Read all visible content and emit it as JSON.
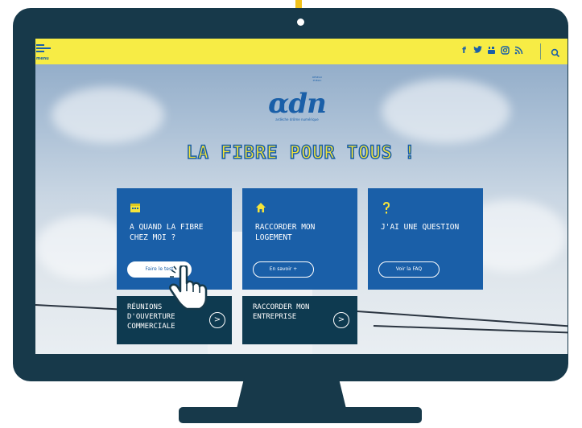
{
  "header": {
    "menu_label": "menu",
    "social_icons": [
      "facebook-icon",
      "twitter-icon",
      "youtube-icon",
      "instagram-icon",
      "rss-icon"
    ],
    "search_icon": "search-icon"
  },
  "logo": {
    "top_text": "RÉSEAU PUBLIC",
    "main_text": "αdn",
    "subtitle": "ardèche drôme numérique"
  },
  "hero": {
    "title": "LA FIBRE POUR TOUS !"
  },
  "cards": [
    {
      "title_line1": "A QUAND LA FIBRE",
      "title_line2": "CHEZ MOI ?",
      "button": "Faire le test",
      "icon": "calendar-icon"
    },
    {
      "title_line1": "RACCORDER MON",
      "title_line2": "LOGEMENT",
      "button": "En savoir +",
      "icon": "house-icon"
    },
    {
      "title_line1": "J'AI UNE QUESTION",
      "title_line2": "",
      "button": "Voir la FAQ",
      "icon": "question-mark-icon"
    }
  ],
  "cards_bottom": [
    {
      "title_line1": "RÉUNIONS",
      "title_line2": "D'OUVERTURE",
      "title_line3": "COMMERCIALE",
      "arrow": ">"
    },
    {
      "title_line1": "RACCORDER MON",
      "title_line2": "ENTREPRISE",
      "title_line3": "",
      "arrow": ">"
    }
  ],
  "colors": {
    "brand_blue": "#1a5fa8",
    "dark_teal": "#0e3a50",
    "header_yellow": "#f7ec45",
    "bezel": "#17394a"
  }
}
